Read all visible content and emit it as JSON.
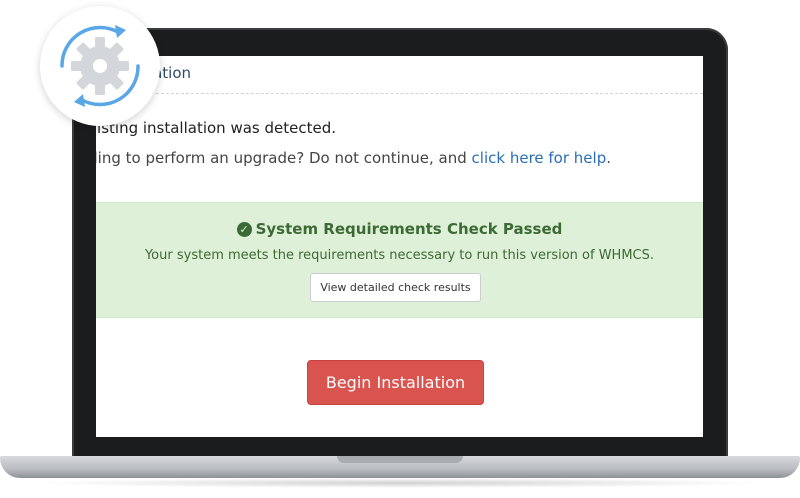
{
  "panel": {
    "title_fragment": "lation"
  },
  "messages": {
    "line1": "isting installation was detected.",
    "line2_text": "ding to perform an upgrade? Do not continue, and ",
    "line2_link": "click here for help",
    "line2_end": "."
  },
  "requirements": {
    "title": "System Requirements Check Passed",
    "text": "Your system meets the requirements necessary to run this version of WHMCS.",
    "details_button": "View detailed check results"
  },
  "actions": {
    "begin_button": "Begin Installation"
  },
  "icons": {
    "badge": "sync-gear-icon",
    "check": "check-circle-icon"
  },
  "colors": {
    "success_bg": "#dff0d8",
    "success_text": "#3c6a34",
    "danger_button": "#d9534f",
    "link": "#2a6fb5",
    "badge_arrows": "#5aa7e8",
    "badge_gear": "#d3d6da"
  }
}
